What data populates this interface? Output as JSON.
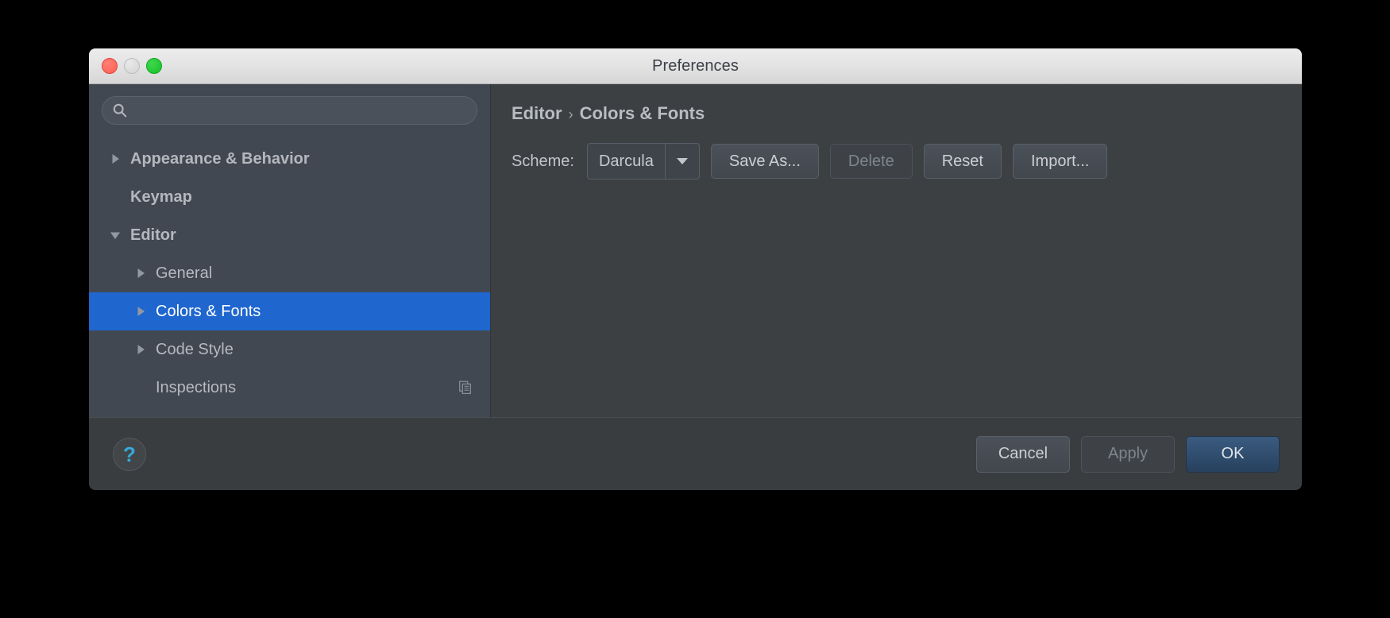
{
  "window": {
    "title": "Preferences",
    "traffic_lights": [
      {
        "name": "close",
        "color": "#fc5d52"
      },
      {
        "name": "minimize",
        "color": "#d3d3d3"
      },
      {
        "name": "zoom",
        "color": "#17c123"
      }
    ]
  },
  "search": {
    "value": "",
    "placeholder": "",
    "icon": "search-icon"
  },
  "sidebar": {
    "items": [
      {
        "label": "Appearance & Behavior",
        "level": 0,
        "twisty": "collapsed",
        "selected": false,
        "badge": null
      },
      {
        "label": "Keymap",
        "level": 0,
        "twisty": "none",
        "selected": false,
        "badge": null
      },
      {
        "label": "Editor",
        "level": 0,
        "twisty": "expanded",
        "selected": false,
        "badge": null
      },
      {
        "label": "General",
        "level": 1,
        "twisty": "collapsed",
        "selected": false,
        "badge": null
      },
      {
        "label": "Colors & Fonts",
        "level": 1,
        "twisty": "collapsed",
        "selected": true,
        "badge": null
      },
      {
        "label": "Code Style",
        "level": 1,
        "twisty": "collapsed",
        "selected": false,
        "badge": null
      },
      {
        "label": "Inspections",
        "level": 1,
        "twisty": "none",
        "selected": false,
        "badge": "copy-icon"
      }
    ],
    "selection_color": "#1f66cf"
  },
  "detail": {
    "breadcrumb": {
      "root": "Editor",
      "separator": "›",
      "leaf": "Colors & Fonts"
    },
    "scheme": {
      "label": "Scheme:",
      "value": "Darcula",
      "arrow_icon": "chevron-down-icon"
    },
    "buttons": [
      {
        "label": "Save As...",
        "enabled": true,
        "primary": false
      },
      {
        "label": "Delete",
        "enabled": false,
        "primary": false
      },
      {
        "label": "Reset",
        "enabled": true,
        "primary": false
      },
      {
        "label": "Import...",
        "enabled": true,
        "primary": false
      }
    ]
  },
  "footer": {
    "help_glyph": "?",
    "help_color": "#35aadc",
    "buttons": [
      {
        "label": "Cancel",
        "enabled": true,
        "primary": false
      },
      {
        "label": "Apply",
        "enabled": false,
        "primary": false
      },
      {
        "label": "OK",
        "enabled": true,
        "primary": true
      }
    ]
  },
  "annotation": {
    "type": "arrow",
    "color": "#f72b5e",
    "points_to": "Import..."
  }
}
